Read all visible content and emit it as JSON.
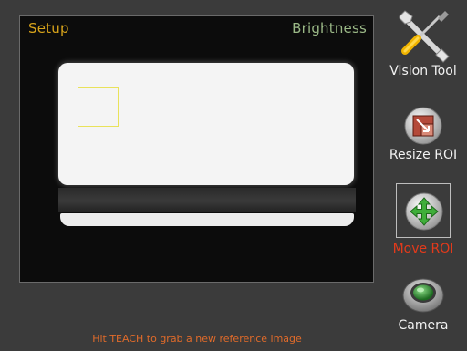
{
  "overlay": {
    "mode": "Setup",
    "tool": "Brightness"
  },
  "status": {
    "message": "Hit TEACH to grab a new reference image"
  },
  "sidebar": {
    "vision_tool": "Vision Tool",
    "resize_roi": "Resize ROI",
    "move_roi": "Move ROI",
    "camera": "Camera"
  },
  "colors": {
    "active_label": "#e33a1b",
    "mode_label": "#d6a21a",
    "tool_label": "#9bb987",
    "roi": "#e9e25a",
    "status": "#e16b2a"
  },
  "icons": [
    "wrench-screwdriver-icon",
    "resize-roi-icon",
    "move-arrows-icon",
    "camera-lens-icon"
  ]
}
